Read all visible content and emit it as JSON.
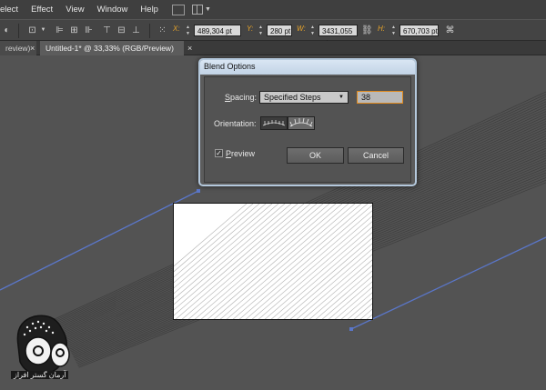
{
  "menubar": {
    "items": [
      "elect",
      "Effect",
      "View",
      "Window",
      "Help"
    ]
  },
  "controlbar": {
    "x_label": "X:",
    "x_value": "489,304 pt",
    "y_label": "Y:",
    "y_value": "280 pt",
    "w_label": "W:",
    "w_value": "3431,055 pt",
    "h_label": "H:",
    "h_value": "670,703 pt"
  },
  "tabs": {
    "inactive_label": "review)",
    "active_label": "Untitled-1* @ 33,33% (RGB/Preview)",
    "close_glyph": "×"
  },
  "dialog": {
    "title": "Blend Options",
    "spacing_label_u": "S",
    "spacing_label_rest": "pacing:",
    "spacing_value": "Specified Steps",
    "steps_value": "38",
    "orientation_label": "Orientation:",
    "preview_label_u": "P",
    "preview_label_rest": "review",
    "preview_checked": "✓",
    "ok_label": "OK",
    "cancel_label": "Cancel"
  },
  "watermark": {
    "text": "آرمان گستر افراز"
  },
  "colors": {
    "accent_label": "#e6a32a",
    "selection_path": "#5a76c8"
  }
}
